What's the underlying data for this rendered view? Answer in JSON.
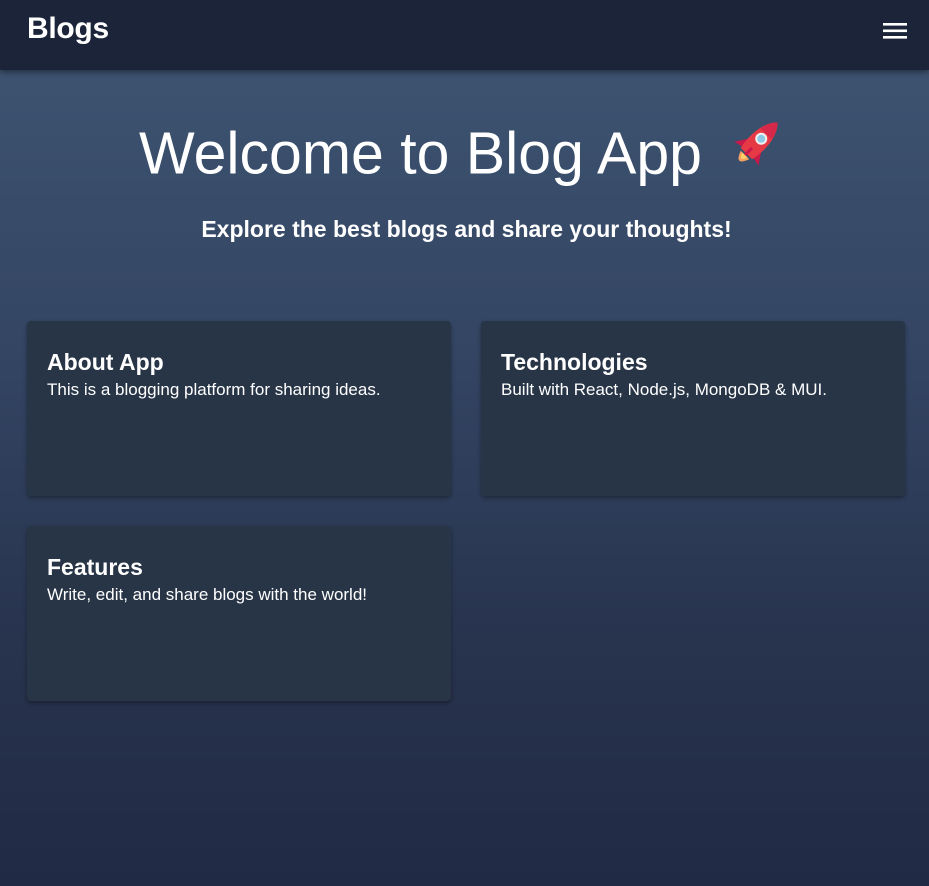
{
  "appbar": {
    "brand": "Blogs",
    "menu_icon": "hamburger-menu-icon"
  },
  "hero": {
    "title": "Welcome to Blog App",
    "title_icon": "rocket-icon",
    "subtitle": "Explore the best blogs and share your thoughts!"
  },
  "cards": [
    {
      "title": "About App",
      "description": "This is a blogging platform for sharing ideas."
    },
    {
      "title": "Technologies",
      "description": "Built with React, Node.js, MongoDB & MUI."
    },
    {
      "title": "Features",
      "description": "Write, edit, and share blogs with the world!"
    }
  ],
  "colors": {
    "appbar": "#1c243a",
    "background_top": "#3f5673",
    "background_bottom": "#212a44",
    "card": "#283547",
    "text": "#ffffff"
  }
}
